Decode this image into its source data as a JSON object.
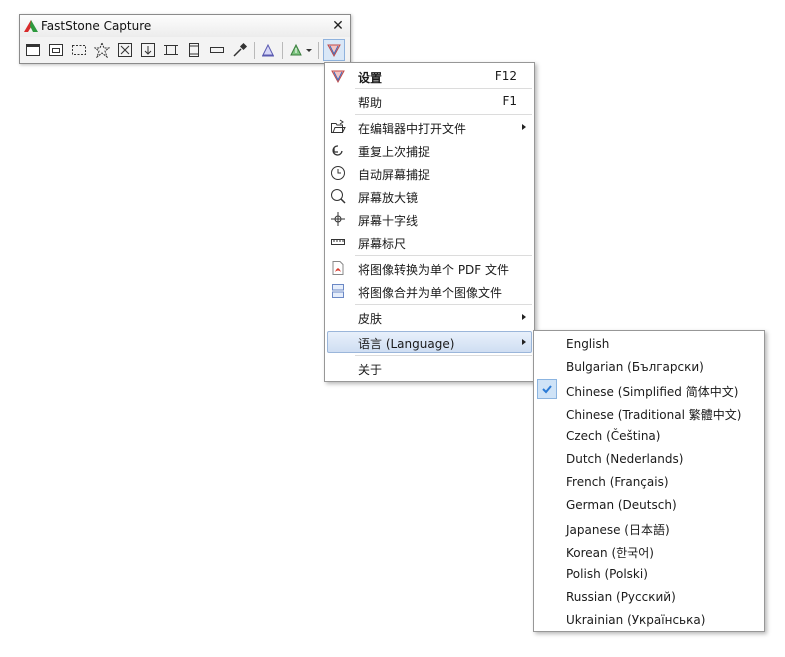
{
  "toolbar": {
    "title": "FastStone Capture",
    "close_glyph": "✕",
    "tools": [
      {
        "name": "capture-active-window-icon"
      },
      {
        "name": "capture-window-object-icon"
      },
      {
        "name": "capture-rectangle-icon"
      },
      {
        "name": "capture-freehand-icon"
      },
      {
        "name": "capture-fullscreen-icon"
      },
      {
        "name": "capture-scrolling-icon"
      },
      {
        "name": "capture-fixed-region-icon"
      },
      {
        "name": "screen-recorder-icon"
      },
      {
        "name": "capture-menu-icon"
      },
      {
        "name": "color-picker-icon"
      },
      {
        "name": "output-editor-icon"
      },
      {
        "name": "output-destination-icon"
      },
      {
        "name": "settings-menu-icon"
      }
    ]
  },
  "menu": {
    "settings": {
      "label": "设置",
      "shortcut": "F12"
    },
    "help": {
      "label": "帮助",
      "shortcut": "F1"
    },
    "open_in_editor": {
      "label": "在编辑器中打开文件"
    },
    "repeat_last": {
      "label": "重复上次捕捉"
    },
    "auto_capture": {
      "label": "自动屏幕捕捉"
    },
    "magnifier": {
      "label": "屏幕放大镜"
    },
    "crosshair": {
      "label": "屏幕十字线"
    },
    "ruler": {
      "label": "屏幕标尺"
    },
    "to_pdf": {
      "label": "将图像转换为单个 PDF 文件"
    },
    "combine": {
      "label": "将图像合并为单个图像文件"
    },
    "skin": {
      "label": "皮肤"
    },
    "language": {
      "label": "语言 (Language)"
    },
    "about": {
      "label": "关于"
    }
  },
  "languages": {
    "items": [
      {
        "label": "English"
      },
      {
        "label": "Bulgarian (Български)"
      },
      {
        "label": "Chinese (Simplified 简体中文)"
      },
      {
        "label": "Chinese (Traditional 繁體中文)"
      },
      {
        "label": "Czech (Čeština)"
      },
      {
        "label": "Dutch (Nederlands)"
      },
      {
        "label": "French (Français)"
      },
      {
        "label": "German (Deutsch)"
      },
      {
        "label": "Japanese (日本語)"
      },
      {
        "label": "Korean (한국어)"
      },
      {
        "label": "Polish (Polski)"
      },
      {
        "label": "Russian (Русский)"
      },
      {
        "label": "Ukrainian (Українська)"
      }
    ],
    "selected": "Chinese (Simplified 简体中文)"
  },
  "colors": {
    "accent": "#2b7bd6",
    "highlight": "#cfdef2",
    "pdf_red": "#d83a2e"
  }
}
